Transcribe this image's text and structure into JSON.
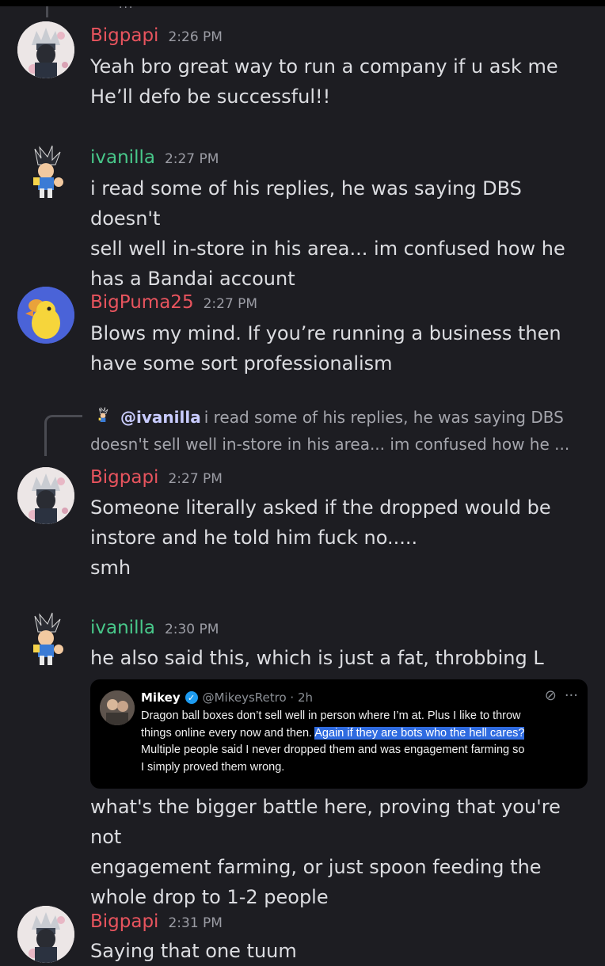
{
  "messages": [
    {
      "author": "Bigpapi",
      "time": "2:26 PM",
      "lines": [
        "Yeah bro great way to run a company if u ask me",
        "He’ll defo be successful!!"
      ]
    },
    {
      "author": "ivanilla",
      "time": "2:27 PM",
      "lines": [
        "i read some of his replies, he was saying DBS doesn't",
        "sell well in-store in his area... im confused how he",
        "has a Bandai account"
      ]
    },
    {
      "author": "BigPuma25",
      "time": "2:27 PM",
      "lines": [
        "Blows my mind. If you’re running a business then",
        "have some sort professionalism"
      ]
    },
    {
      "reply_to": {
        "mention": "@ivanilla",
        "line1": "i read some of his replies, he was saying DBS",
        "line2": "doesn't sell well in-store in his area... im confused how he ..."
      },
      "author": "Bigpapi",
      "time": "2:27 PM",
      "lines": [
        "Someone literally asked if the dropped would be",
        "instore and he told him fuck no.....",
        "smh"
      ]
    },
    {
      "author": "ivanilla",
      "time": "2:30 PM",
      "lines": [
        "he also said this, which is just a fat, throbbing L"
      ],
      "embed": {
        "name": "Mikey",
        "handle": "@MikeysRetro · 2h",
        "line1": "Dragon ball boxes don’t sell well in person where I’m at. Plus I like to throw",
        "line2_plain": "things online every now and then. ",
        "line2_highlight": "Again if they are bots who the hell cares?",
        "line3": "Multiple people said I never dropped them and was engagement farming so",
        "line4": "I simply proved them wrong."
      },
      "after_lines": [
        "what's the bigger battle here, proving that you're not",
        "engagement farming, or just spoon feeding the",
        "whole drop to 1-2 people"
      ]
    },
    {
      "author": "Bigpapi",
      "time": "2:31 PM",
      "lines": [
        "Saying that one tuum"
      ]
    }
  ],
  "colors": {
    "background": "#1d1d22",
    "bigpapi_name": "#e8545e",
    "ivanilla_name": "#48c88a",
    "bigpuma_name": "#e8545e",
    "mention": "#c9ccff",
    "highlight": "#2f6be0"
  },
  "icons": [
    "avatar-kakashi",
    "avatar-gotenks",
    "avatar-duck",
    "verified-badge-icon",
    "grok-icon",
    "more-icon"
  ],
  "thread_dots": "..."
}
